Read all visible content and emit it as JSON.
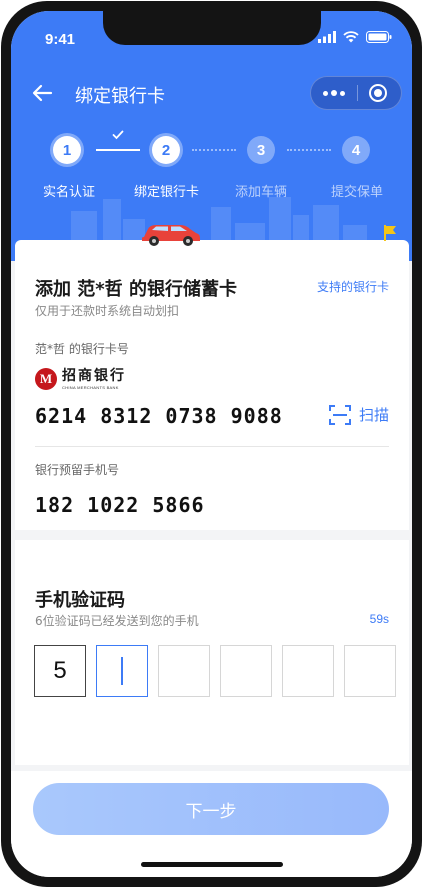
{
  "status_bar": {
    "time": "9:41"
  },
  "nav": {
    "title": "绑定银行卡"
  },
  "steps": [
    {
      "number": "1",
      "label": "实名认证",
      "state": "done"
    },
    {
      "number": "2",
      "label": "绑定银行卡",
      "state": "active"
    },
    {
      "number": "3",
      "label": "添加车辆",
      "state": "todo"
    },
    {
      "number": "4",
      "label": "提交保单",
      "state": "todo"
    }
  ],
  "card_section": {
    "title": "添加 范*哲 的银行储蓄卡",
    "subtitle": "仅用于还款时系统自动划扣",
    "supported_banks_link": "支持的银行卡",
    "card_number_label": "范*哲 的银行卡号",
    "bank": {
      "logo_letter": "M",
      "name": "招商银行",
      "name_en": "CHINA MERCHANTS BANK"
    },
    "card_number": "6214 8312 0738 9088",
    "scan_label": "扫描",
    "phone_label": "银行预留手机号",
    "phone_number": "182 1022 5866"
  },
  "sms_section": {
    "title": "手机验证码",
    "subtitle": "6位验证码已经发送到您的手机",
    "countdown": "59s",
    "code_digits": [
      "5",
      "",
      "",
      "",
      "",
      ""
    ]
  },
  "footer": {
    "next_button_label": "下一步"
  },
  "colors": {
    "primary": "#3d7bf6",
    "button_disabled": "#a9c8fc",
    "bank_red": "#c5171c"
  }
}
